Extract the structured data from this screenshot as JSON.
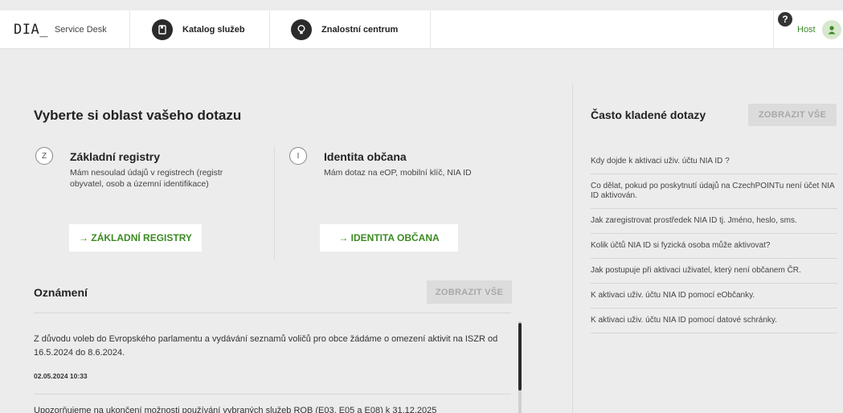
{
  "header": {
    "logo": "DIA_",
    "subtitle": "Service Desk",
    "nav": [
      {
        "label": "Katalog služeb",
        "icon": "catalog-icon"
      },
      {
        "label": "Znalostní centrum",
        "icon": "lightbulb-icon"
      }
    ],
    "help_icon": "?",
    "user_label": "Host"
  },
  "main": {
    "title": "Vyberte si oblast vašeho dotazu",
    "areas": [
      {
        "badge": "Z",
        "title": "Základní registry",
        "description": "Mám nesoulad údajů v registrech (registr obyvatel, osob a územní identifikace)",
        "button": "→ ZÁKLADNÍ REGISTRY"
      },
      {
        "badge": "I",
        "title": "Identita občana",
        "description": "Mám dotaz na eOP, mobilní klíč, NIA ID",
        "button": "→ IDENTITA OBČANA"
      }
    ]
  },
  "announcements": {
    "title": "Oznámení",
    "show_all": "ZOBRAZIT VŠE",
    "items": [
      {
        "text": "Z důvodu voleb do Evropského parlamentu a vydávání seznamů voličů pro obce žádáme o omezení aktivit na ISZR od 16.5.2024 do 8.6.2024.",
        "date": "02.05.2024 10:33"
      },
      {
        "text": "Upozorňujeme na ukončení možnosti používání vybraných služeb ROB (E03, E05 a E08) k 31.12.2025",
        "date": ""
      }
    ]
  },
  "faq": {
    "title": "Často kladené dotazy",
    "show_all": "ZOBRAZIT VŠE",
    "items": [
      "Kdy dojde k aktivaci uživ. účtu NIA ID ?",
      "Co dělat, pokud po poskytnutí údajů na CzechPOINTu není účet NIA ID aktivován.",
      "Jak zaregistrovat prostředek NIA ID tj. Jméno, heslo, sms.",
      "Kolik účtů NIA ID si fyzická osoba může aktivovat?",
      "Jak postupuje při aktivaci uživatel, který není občanem ČR.",
      "K aktivaci uživ. účtu NIA ID pomocí eObčanky.",
      "K aktivaci uživ. účtu NIA ID pomocí datové schránky."
    ]
  },
  "colors": {
    "accent_green": "#3c8a22",
    "background": "#ececec"
  }
}
